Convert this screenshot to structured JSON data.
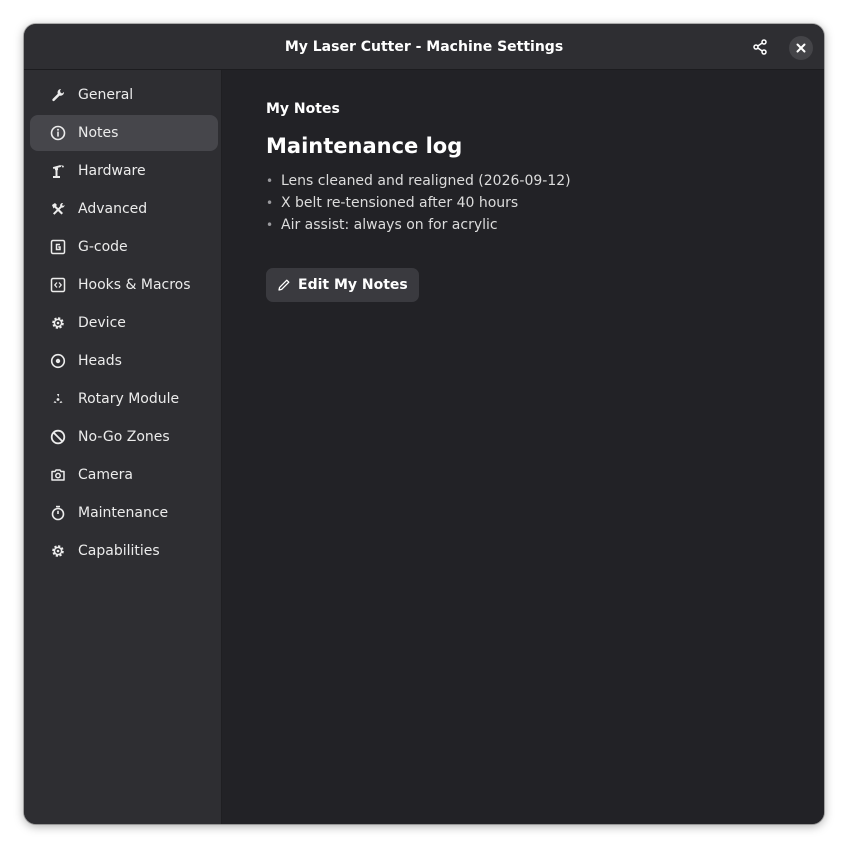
{
  "window": {
    "title": "My Laser Cutter - Machine Settings"
  },
  "titlebar": {
    "share_icon": "share-icon",
    "close_icon": "close-icon"
  },
  "sidebar": {
    "items": [
      {
        "label": "General",
        "icon": "wrench-icon",
        "active": false
      },
      {
        "label": "Notes",
        "icon": "info-icon",
        "active": true
      },
      {
        "label": "Hardware",
        "icon": "robot-arm-icon",
        "active": false
      },
      {
        "label": "Advanced",
        "icon": "tools-icon",
        "active": false
      },
      {
        "label": "G-code",
        "icon": "gcode-icon",
        "active": false
      },
      {
        "label": "Hooks & Macros",
        "icon": "code-icon",
        "active": false
      },
      {
        "label": "Device",
        "icon": "gear-icon",
        "active": false
      },
      {
        "label": "Heads",
        "icon": "target-icon",
        "active": false
      },
      {
        "label": "Rotary Module",
        "icon": "rotary-icon",
        "active": false
      },
      {
        "label": "No-Go Zones",
        "icon": "prohibited-icon",
        "active": false
      },
      {
        "label": "Camera",
        "icon": "camera-icon",
        "active": false
      },
      {
        "label": "Maintenance",
        "icon": "stopwatch-icon",
        "active": false
      },
      {
        "label": "Capabilities",
        "icon": "gear-icon",
        "active": false
      }
    ]
  },
  "main": {
    "section_label": "My Notes",
    "note_heading": "Maintenance log",
    "note_items": [
      "Lens cleaned and realigned (2026-09-12)",
      "X belt re-tensioned after 40 hours",
      "Air assist: always on for acrylic"
    ],
    "edit_button_label": "Edit My Notes"
  },
  "colors": {
    "window_bg": "#222226",
    "sidebar_bg": "#2e2e32",
    "active_item_bg": "#46464b",
    "button_bg": "#3a3a3f",
    "text": "#ffffff"
  }
}
